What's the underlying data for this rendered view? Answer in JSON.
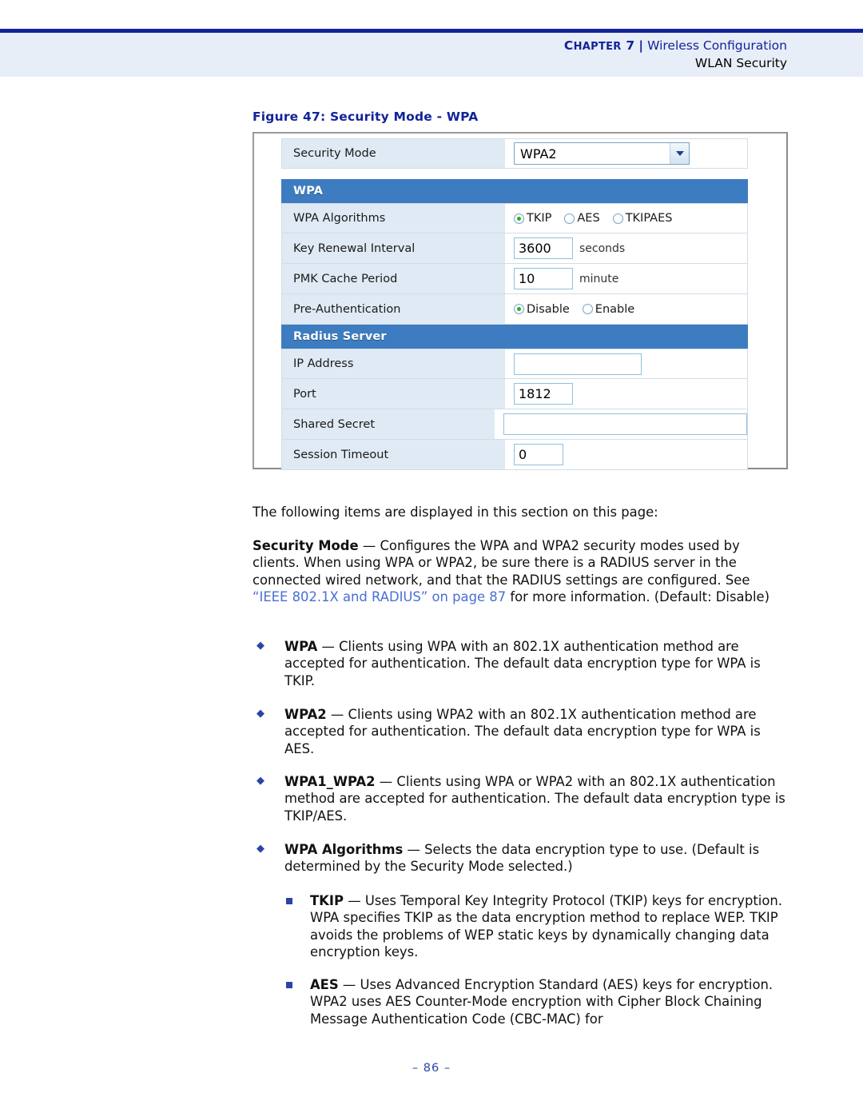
{
  "header": {
    "chapter_label": "CHAPTER",
    "chapter_number": "7",
    "separator": "|",
    "section_title": "Wireless Configuration",
    "subsection_title": "WLAN Security"
  },
  "figure": {
    "caption": "Figure 47:  Security Mode - WPA",
    "ui": {
      "security_mode": {
        "label": "Security Mode",
        "value": "WPA2",
        "dropdown_icon": "chevron-down-icon"
      },
      "wpa_section": {
        "title": "WPA",
        "rows": [
          {
            "label": "WPA Algorithms",
            "type": "radio",
            "options": [
              {
                "label": "TKIP",
                "selected": true
              },
              {
                "label": "AES",
                "selected": false
              },
              {
                "label": "TKIPAES",
                "selected": false
              }
            ]
          },
          {
            "label": "Key Renewal Interval",
            "type": "text",
            "value": "3600",
            "unit": "seconds"
          },
          {
            "label": "PMK Cache Period",
            "type": "text",
            "value": "10",
            "unit": "minute"
          },
          {
            "label": "Pre-Authentication",
            "type": "radio",
            "options": [
              {
                "label": "Disable",
                "selected": true
              },
              {
                "label": "Enable",
                "selected": false
              }
            ]
          }
        ]
      },
      "radius_section": {
        "title": "Radius Server",
        "rows": [
          {
            "label": "IP Address",
            "type": "text",
            "value": ""
          },
          {
            "label": "Port",
            "type": "text",
            "value": "1812"
          },
          {
            "label": "Shared Secret",
            "type": "text",
            "value": ""
          },
          {
            "label": "Session Timeout",
            "type": "text",
            "value": "0"
          }
        ]
      }
    }
  },
  "body": {
    "intro": "The following items are displayed in this section on this page:",
    "security_mode": {
      "term": "Security Mode",
      "dash": " — ",
      "text_before_link": "Configures the WPA and WPA2 security modes used by clients. When using WPA or WPA2, be sure there is a RADIUS server in the connected wired network, and that the RADIUS settings are configured. See ",
      "link": "“IEEE 802.1X and RADIUS” on page 87",
      "text_after_link": " for more information. (Default: Disable)"
    },
    "bullets": [
      {
        "term": "WPA",
        "dash": " — ",
        "text": "Clients using WPA with an 802.1X authentication method are accepted for authentication. The default data encryption type for WPA is TKIP."
      },
      {
        "term": "WPA2",
        "dash": " — ",
        "text": "Clients using WPA2 with an 802.1X authentication method are accepted for authentication. The default data encryption type for WPA is AES."
      },
      {
        "term": "WPA1_WPA2",
        "dash": " — ",
        "text": "Clients using WPA or WPA2 with an 802.1X authentication method are accepted for authentication. The default data encryption type is TKIP/AES."
      },
      {
        "term": "WPA Algorithms",
        "dash": " — ",
        "text": "Selects the data encryption type to use. (Default is determined by the Security Mode selected.)"
      }
    ],
    "sub_bullets": [
      {
        "term": "TKIP",
        "dash": " — ",
        "text": "Uses Temporal Key Integrity Protocol (TKIP) keys for encryption. WPA specifies TKIP as the data encryption method to replace WEP. TKIP avoids the problems of WEP static keys by dynamically changing data encryption keys."
      },
      {
        "term": "AES",
        "dash": " — ",
        "text": "Uses Advanced Encryption Standard (AES) keys for encryption. WPA2 uses AES Counter-Mode encryption with Cipher Block Chaining Message Authentication Code (CBC-MAC) for"
      }
    ]
  },
  "footer": {
    "page_number": "–  86  –"
  },
  "colors": {
    "accent_navy": "#12239b",
    "header_band": "#e8eef7",
    "link_blue": "#4a6fd4",
    "section_bar": "#3d7cc0",
    "field_label_bg": "#dfeaf4",
    "radio_on": "#22b422"
  }
}
